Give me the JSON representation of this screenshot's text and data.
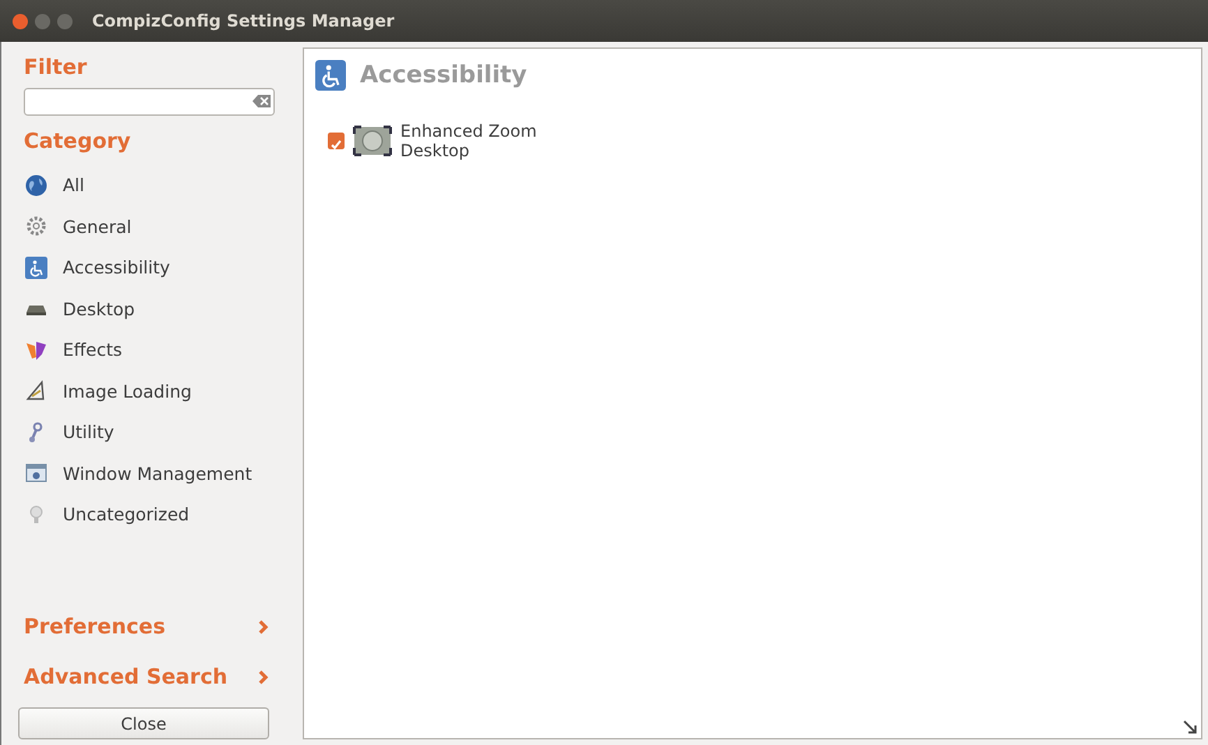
{
  "window": {
    "title": "CompizConfig Settings Manager"
  },
  "sidebar": {
    "filter_label": "Filter",
    "category_label": "Category",
    "categories": [
      {
        "label": "All",
        "kind": "globe"
      },
      {
        "label": "General",
        "kind": "gear"
      },
      {
        "label": "Accessibility",
        "kind": "wheelchair"
      },
      {
        "label": "Desktop",
        "kind": "desk"
      },
      {
        "label": "Effects",
        "kind": "effects"
      },
      {
        "label": "Image Loading",
        "kind": "image"
      },
      {
        "label": "Utility",
        "kind": "utility"
      },
      {
        "label": "Window Management",
        "kind": "window"
      },
      {
        "label": "Uncategorized",
        "kind": "bulb"
      }
    ],
    "sections": [
      {
        "label": "Preferences"
      },
      {
        "label": "Advanced Search"
      }
    ],
    "close_button": "Close"
  },
  "content": {
    "heading": "Accessibility",
    "plugins": [
      {
        "label": "Enhanced Zoom Desktop",
        "checked": true
      }
    ]
  }
}
